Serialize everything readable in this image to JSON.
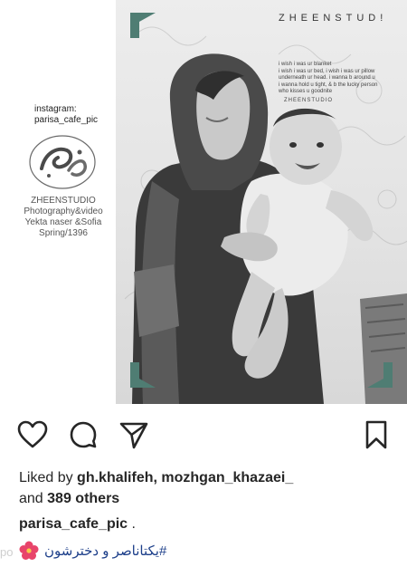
{
  "post": {
    "image_left": {
      "instagram_label": "instagram:",
      "instagram_handle": "parisa_cafe_pic",
      "studio_name": "ZHEENSTUDIO",
      "studio_service": "Photography&video",
      "subjects": "Yekta naser &Sofia",
      "season": "Spring/1396"
    },
    "image_right": {
      "brand": "ZHEENSTUD!",
      "poem_lines": [
        "i wish i was ur blanket",
        "i wish i was ur bed, i wish i was ur pillow",
        "underneath ur head. i wanna b around u",
        "i wanna hold u tight, & b the lucky person",
        "who kisses u goodnite"
      ],
      "poem_logo": "ZHEENSTUDIO"
    }
  },
  "actions": {
    "like_icon": "heart-outline",
    "comment_icon": "speech-bubble",
    "share_icon": "paper-plane",
    "save_icon": "bookmark"
  },
  "likes": {
    "prefix": "Liked by",
    "users": "gh.khalifeh, mozhgan_khazaei_",
    "conjunction": "and",
    "others": "389 others"
  },
  "caption": {
    "username": "parisa_cafe_pic",
    "suffix": ".",
    "emoji": "hibiscus",
    "text": "#یکتاناصر و دخترشون"
  },
  "watermark": "po",
  "colors": {
    "text": "#262626",
    "hashtag": "#1d3f8a",
    "corner_accent": "#4f7d73"
  }
}
